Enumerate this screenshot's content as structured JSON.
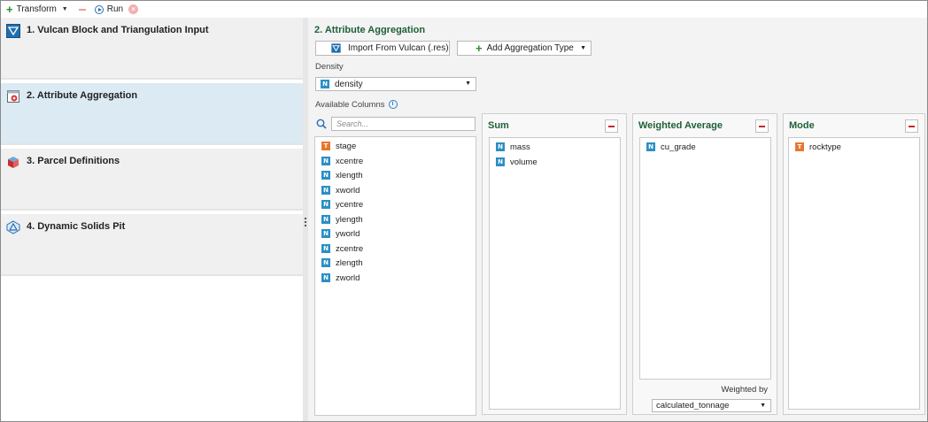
{
  "toolbar": {
    "transform_label": "Transform",
    "run_label": "Run",
    "stop_glyph": "×"
  },
  "steps": [
    {
      "label": "1.  Vulcan Block and Triangulation Input",
      "icon": "triangle-down-icon"
    },
    {
      "label": "2.  Attribute Aggregation",
      "icon": "aggregation-icon"
    },
    {
      "label": "3.  Parcel Definitions",
      "icon": "cube-icon"
    },
    {
      "label": "4.  Dynamic Solids Pit",
      "icon": "pit-icon"
    }
  ],
  "main": {
    "title": "2. Attribute Aggregation",
    "import_label": "Import From Vulcan (.res)",
    "add_agg_label": "Add Aggregation Type",
    "density_label": "Density",
    "density_value": "density",
    "available_label": "Available Columns",
    "search_placeholder": "Search..."
  },
  "available_columns": [
    {
      "type": "T",
      "name": "stage"
    },
    {
      "type": "N",
      "name": "xcentre"
    },
    {
      "type": "N",
      "name": "xlength"
    },
    {
      "type": "N",
      "name": "xworld"
    },
    {
      "type": "N",
      "name": "ycentre"
    },
    {
      "type": "N",
      "name": "ylength"
    },
    {
      "type": "N",
      "name": "yworld"
    },
    {
      "type": "N",
      "name": "zcentre"
    },
    {
      "type": "N",
      "name": "zlength"
    },
    {
      "type": "N",
      "name": "zworld"
    }
  ],
  "aggregations": {
    "sum": {
      "title": "Sum",
      "columns": [
        {
          "type": "N",
          "name": "mass"
        },
        {
          "type": "N",
          "name": "volume"
        }
      ]
    },
    "weighted": {
      "title": "Weighted Average",
      "columns": [
        {
          "type": "N",
          "name": "cu_grade"
        }
      ],
      "weighted_by_label": "Weighted by",
      "weighted_by_value": "calculated_tonnage"
    },
    "mode": {
      "title": "Mode",
      "columns": [
        {
          "type": "T",
          "name": "rocktype"
        }
      ]
    }
  },
  "colors": {
    "accent_title": "#1f5f38",
    "active_step": "#dbeaf3",
    "numeric_badge": "#2b8fc4",
    "text_badge": "#e8772e"
  }
}
